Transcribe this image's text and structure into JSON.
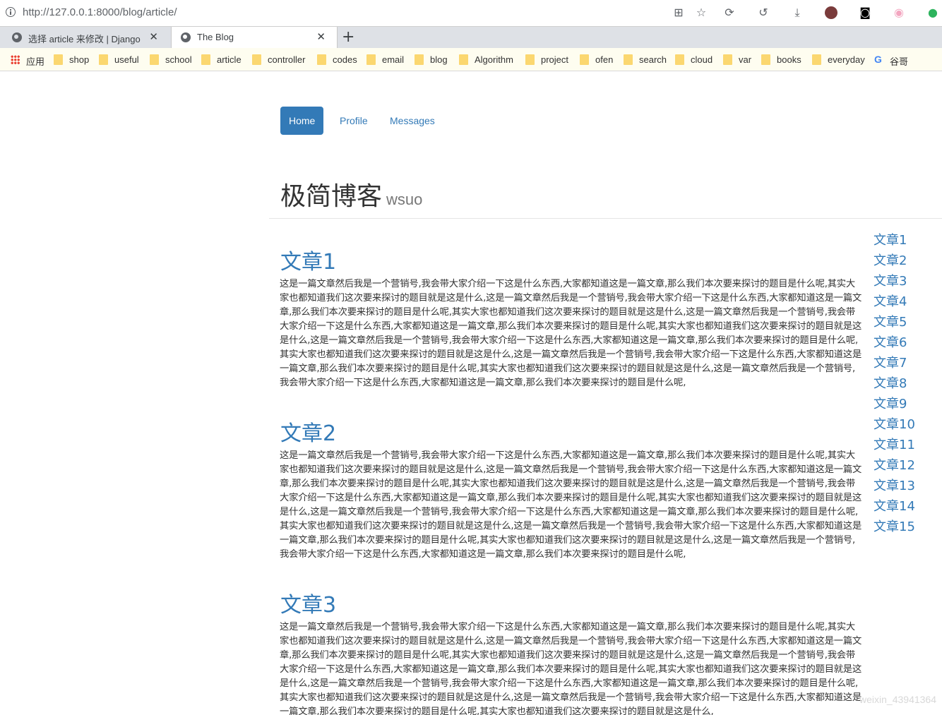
{
  "browser": {
    "url": "http://127.0.0.1:8000/blog/article/",
    "tabs": [
      {
        "title": "选择 article 来修改 | Django 站"
      },
      {
        "title": "The Blog"
      }
    ],
    "bookmarks": [
      "应用",
      "shop",
      "useful",
      "school",
      "article",
      "controller",
      "codes",
      "email",
      "blog",
      "Algorithm",
      "project",
      "ofen",
      "search",
      "cloud",
      "var",
      "books",
      "everyday",
      "谷哥"
    ]
  },
  "nav": {
    "items": [
      "Home",
      "Profile",
      "Messages"
    ],
    "active": "Home"
  },
  "header": {
    "title": "极简博客",
    "subtitle": "wsuo"
  },
  "articles": [
    {
      "title": "文章1",
      "body": "这是一篇文章然后我是一个营销号,我会带大家介绍一下这是什么东西,大家都知道这是一篇文章,那么我们本次要来探讨的题目是什么呢,其实大家也都知道我们这次要来探讨的题目就是这是什么,这是一篇文章然后我是一个营销号,我会带大家介绍一下这是什么东西,大家都知道这是一篇文章,那么我们本次要来探讨的题目是什么呢,其实大家也都知道我们这次要来探讨的题目就是这是什么,这是一篇文章然后我是一个营销号,我会带大家介绍一下这是什么东西,大家都知道这是一篇文章,那么我们本次要来探讨的题目是什么呢,其实大家也都知道我们这次要来探讨的题目就是这是什么,这是一篇文章然后我是一个营销号,我会带大家介绍一下这是什么东西,大家都知道这是一篇文章,那么我们本次要来探讨的题目是什么呢,其实大家也都知道我们这次要来探讨的题目就是这是什么,这是一篇文章然后我是一个营销号,我会带大家介绍一下这是什么东西,大家都知道这是一篇文章,那么我们本次要来探讨的题目是什么呢,其实大家也都知道我们这次要来探讨的题目就是这是什么,这是一篇文章然后我是一个营销号,我会带大家介绍一下这是什么东西,大家都知道这是一篇文章,那么我们本次要来探讨的题目是什么呢,"
    },
    {
      "title": "文章2",
      "body": "这是一篇文章然后我是一个营销号,我会带大家介绍一下这是什么东西,大家都知道这是一篇文章,那么我们本次要来探讨的题目是什么呢,其实大家也都知道我们这次要来探讨的题目就是这是什么,这是一篇文章然后我是一个营销号,我会带大家介绍一下这是什么东西,大家都知道这是一篇文章,那么我们本次要来探讨的题目是什么呢,其实大家也都知道我们这次要来探讨的题目就是这是什么,这是一篇文章然后我是一个营销号,我会带大家介绍一下这是什么东西,大家都知道这是一篇文章,那么我们本次要来探讨的题目是什么呢,其实大家也都知道我们这次要来探讨的题目就是这是什么,这是一篇文章然后我是一个营销号,我会带大家介绍一下这是什么东西,大家都知道这是一篇文章,那么我们本次要来探讨的题目是什么呢,其实大家也都知道我们这次要来探讨的题目就是这是什么,这是一篇文章然后我是一个营销号,我会带大家介绍一下这是什么东西,大家都知道这是一篇文章,那么我们本次要来探讨的题目是什么呢,其实大家也都知道我们这次要来探讨的题目就是这是什么,这是一篇文章然后我是一个营销号,我会带大家介绍一下这是什么东西,大家都知道这是一篇文章,那么我们本次要来探讨的题目是什么呢,"
    },
    {
      "title": "文章3",
      "body": "这是一篇文章然后我是一个营销号,我会带大家介绍一下这是什么东西,大家都知道这是一篇文章,那么我们本次要来探讨的题目是什么呢,其实大家也都知道我们这次要来探讨的题目就是这是什么,这是一篇文章然后我是一个营销号,我会带大家介绍一下这是什么东西,大家都知道这是一篇文章,那么我们本次要来探讨的题目是什么呢,其实大家也都知道我们这次要来探讨的题目就是这是什么,这是一篇文章然后我是一个营销号,我会带大家介绍一下这是什么东西,大家都知道这是一篇文章,那么我们本次要来探讨的题目是什么呢,其实大家也都知道我们这次要来探讨的题目就是这是什么,这是一篇文章然后我是一个营销号,我会带大家介绍一下这是什么东西,大家都知道这是一篇文章,那么我们本次要来探讨的题目是什么呢,其实大家也都知道我们这次要来探讨的题目就是这是什么,这是一篇文章然后我是一个营销号,我会带大家介绍一下这是什么东西,大家都知道这是一篇文章,那么我们本次要来探讨的题目是什么呢,其实大家也都知道我们这次要来探讨的题目就是这是什么,"
    }
  ],
  "toc": [
    "文章1",
    "文章2",
    "文章3",
    "文章4",
    "文章5",
    "文章6",
    "文章7",
    "文章8",
    "文章9",
    "文章10",
    "文章11",
    "文章12",
    "文章13",
    "文章14",
    "文章15"
  ],
  "watermark": "weixin_43941364",
  "colors": {
    "link": "#337ab7",
    "text": "#333333",
    "muted": "#777777"
  }
}
